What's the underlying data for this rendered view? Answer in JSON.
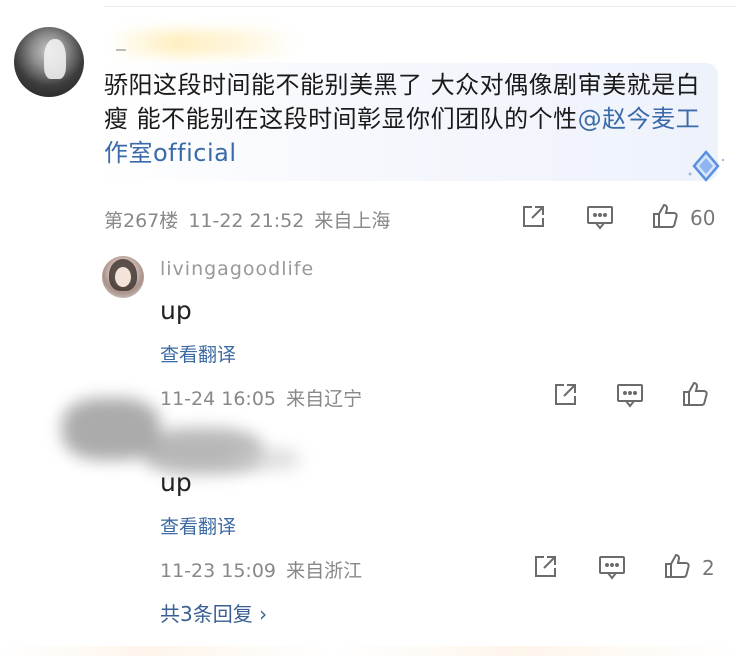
{
  "comment": {
    "text_main": "骄阳这段时间能不能别美黑了 大众对偶像剧审美就是白瘦 能不能别在这段时间彰显你们团队的个性",
    "mention": "@赵今麦工作室official",
    "floor": "第267楼",
    "time": "11-22 21:52",
    "location": "来自上海",
    "like_count": "60"
  },
  "replies": [
    {
      "username": "livingagoodlife",
      "text": "up",
      "translate_label": "查看翻译",
      "time": "11-24 16:05",
      "location": "来自辽宁",
      "like_count": ""
    },
    {
      "username": "",
      "text": "up",
      "translate_label": "查看翻译",
      "time": "11-23 15:09",
      "location": "来自浙江",
      "like_count": "2"
    }
  ],
  "replies_summary": "共3条回复 ›",
  "icons": {
    "share": "share-icon",
    "comment": "comment-icon",
    "like": "thumbs-up-icon",
    "badge": "diamond-badge-icon"
  },
  "colors": {
    "link": "#3a6aa9",
    "meta": "#888888",
    "bubble": "#eef2fb"
  }
}
